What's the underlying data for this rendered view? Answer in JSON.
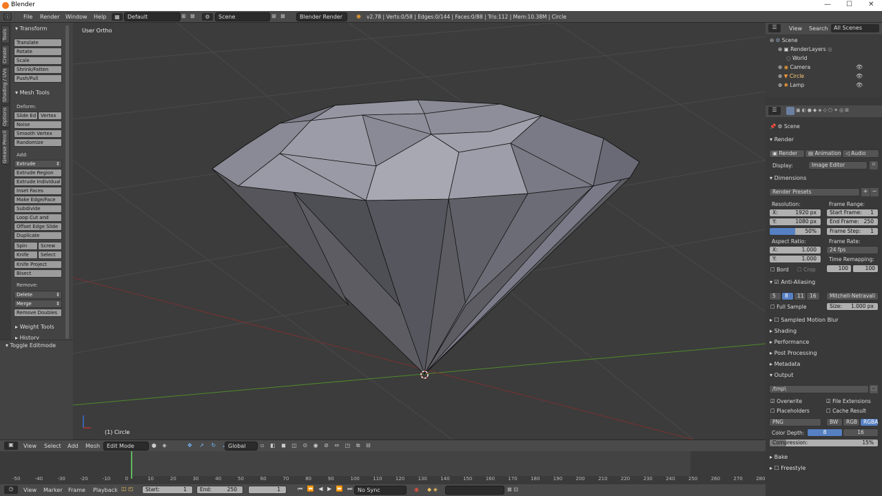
{
  "window": {
    "title": "Blender",
    "min": "—",
    "max": "☐",
    "close": "✕"
  },
  "header": {
    "menus": [
      "File",
      "Render",
      "Window",
      "Help"
    ],
    "layout": "Default",
    "scene": "Scene",
    "engine": "Blender Render",
    "stats": "v2.78 | Verts:0/58 | Edges:0/144 | Faces:0/88 | Tris:112 | Mem:10.38M | Circle"
  },
  "tabs": [
    "Tools",
    "Create",
    "Shading / UVs",
    "Options",
    "Grease Pencil"
  ],
  "toolshelf": {
    "transform_hdr": "Transform",
    "transform": [
      "Translate",
      "Rotate",
      "Scale",
      "Shrink/Fatten",
      "Push/Pull"
    ],
    "mesh_hdr": "Mesh Tools",
    "deform_lbl": "Deform:",
    "slide_edge": "Slide Ed",
    "vertex": "Vertex",
    "deform": [
      "Noise",
      "Smooth Vertex",
      "Randomize"
    ],
    "add_lbl": "Add:",
    "extrude": "Extrude",
    "add": [
      "Extrude Region",
      "Extrude Individual",
      "Inset Faces",
      "Make Edge/Face",
      "Subdivide",
      "Loop Cut and Slide",
      "Offset Edge Slide",
      "Duplicate"
    ],
    "spin": "Spin",
    "screw": "Screw",
    "knife": "Knife",
    "select": "Select",
    "add2": [
      "Knife Project",
      "Bisect"
    ],
    "remove_lbl": "Remove:",
    "delete": "Delete",
    "merge": "Merge",
    "remove_doubles": "Remove Doubles",
    "weight_tools": "Weight Tools",
    "history": "History",
    "toggle_edit": "Toggle Editmode"
  },
  "viewport": {
    "mode_label": "User Ortho",
    "object_label": "(1) Circle"
  },
  "outliner": {
    "view": "View",
    "search": "Search",
    "filter": "All Scenes",
    "items": [
      "Scene",
      "RenderLayers",
      "World",
      "Camera",
      "Circle",
      "Lamp"
    ]
  },
  "properties": {
    "scene": "Scene",
    "render_hdr": "Render",
    "render_btn": "Render",
    "animation_btn": "Animation",
    "audio_btn": "Audio",
    "display_lbl": "Display:",
    "display_val": "Image Editor",
    "dimensions_hdr": "Dimensions",
    "presets": "Render Presets",
    "resolution_lbl": "Resolution:",
    "res_x": "1920 px",
    "res_y": "1080 px",
    "res_pct": "50%",
    "x_lbl": "X:",
    "y_lbl": "Y:",
    "frame_range_lbl": "Frame Range:",
    "start_frame": "Start Frame:",
    "start_val": "1",
    "end_frame": "End Frame:",
    "end_val": "250",
    "frame_step": "Frame Step:",
    "step_val": "1",
    "aspect_lbl": "Aspect Ratio:",
    "aspect_x": "1.000",
    "aspect_y": "1.000",
    "frame_rate_lbl": "Frame Rate:",
    "fps": "24 fps",
    "time_remap_lbl": "Time Remapping:",
    "remap_old": "100",
    "remap_new": "100",
    "bord": "Bord",
    "crop": "Crop",
    "aa_hdr": "Anti-Aliasing",
    "aa_samples": [
      "5",
      "8",
      "11",
      "16"
    ],
    "aa_filter": "Mitchell-Netravali",
    "full_sample": "Full Sample",
    "size": "Size:",
    "size_val": "1.000 px",
    "motion_blur": "Sampled Motion Blur",
    "shading": "Shading",
    "performance": "Performance",
    "post": "Post Processing",
    "metadata": "Metadata",
    "output_hdr": "Output",
    "output_path": "/tmp\\",
    "overwrite": "Overwrite",
    "file_ext": "File Extensions",
    "placeholders": "Placeholders",
    "cache": "Cache Result",
    "format": "PNG",
    "bw": "BW",
    "rgb": "RGB",
    "rgba": "RGBA",
    "color_depth_lbl": "Color Depth:",
    "depth8": "8",
    "depth16": "16",
    "compression_lbl": "Compression:",
    "compression_val": "15%",
    "bake": "Bake",
    "freestyle": "Freestyle"
  },
  "view3d_header": {
    "menus": [
      "View",
      "Select",
      "Add",
      "Mesh"
    ],
    "mode": "Edit Mode",
    "orientation": "Global"
  },
  "timeline": {
    "ticks": [
      "-50",
      "-40",
      "-30",
      "-20",
      "-10",
      "0",
      "10",
      "20",
      "30",
      "40",
      "50",
      "60",
      "70",
      "80",
      "90",
      "100",
      "110",
      "120",
      "130",
      "140",
      "150",
      "160",
      "170",
      "180",
      "190",
      "200",
      "210",
      "220",
      "230",
      "240",
      "250",
      "260",
      "270",
      "280"
    ],
    "menus": [
      "View",
      "Marker",
      "Frame",
      "Playback"
    ],
    "start_lbl": "Start:",
    "start": "1",
    "end_lbl": "End:",
    "end": "250",
    "current": "1",
    "sync": "No Sync"
  }
}
